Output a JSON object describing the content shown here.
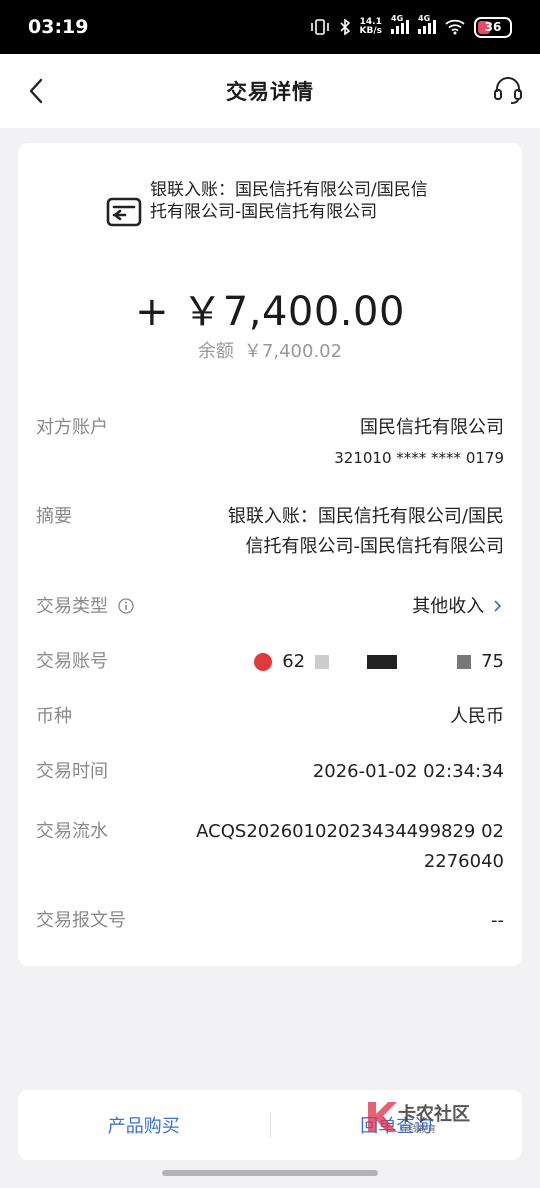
{
  "status_bar": {
    "time": "03:19",
    "net_speed_value": "14.1",
    "net_speed_unit": "KB/s",
    "signal1_label": "4G",
    "signal2_label": "4G",
    "battery": "36"
  },
  "nav": {
    "title": "交易详情",
    "back_icon": "chevron-left-icon",
    "support_icon": "headset-icon"
  },
  "header": {
    "icon": "card-transfer-icon",
    "description": "银联入账：国民信托有限公司/国民信托有限公司-国民信托有限公司"
  },
  "amount": "+ ￥7,400.00",
  "balance": {
    "label": "余额",
    "value": "￥7,400.02"
  },
  "details": {
    "counterparty": {
      "label": "对方账户",
      "name": "国民信托有限公司",
      "account": "321010 **** **** 0179"
    },
    "summary": {
      "label": "摘要",
      "line1": "银联入账：国民信托有限公司/国民",
      "line2": "信托有限公司-国民信托有限公司"
    },
    "type": {
      "label": "交易类型",
      "value": "其他收入"
    },
    "account": {
      "label": "交易账号",
      "value_start": "62",
      "value_end": "75"
    },
    "currency": {
      "label": "币种",
      "value": "人民币"
    },
    "time": {
      "label": "交易时间",
      "value": "2026-01-02 02:34:34"
    },
    "serial": {
      "label": "交易流水",
      "line1": "ACQS20260102023434499829 02",
      "line2": "2276040"
    },
    "message_no": {
      "label": "交易报文号",
      "value": "--"
    }
  },
  "bottom": {
    "product_purchase": "产品购买",
    "receipt_query": "回单查询"
  },
  "watermark": {
    "title": "卡农社区",
    "subtitle": "在线教育"
  },
  "colors": {
    "accent": "#3b6fd6",
    "background": "#f2f2f4",
    "battery": "#e84a5f"
  }
}
